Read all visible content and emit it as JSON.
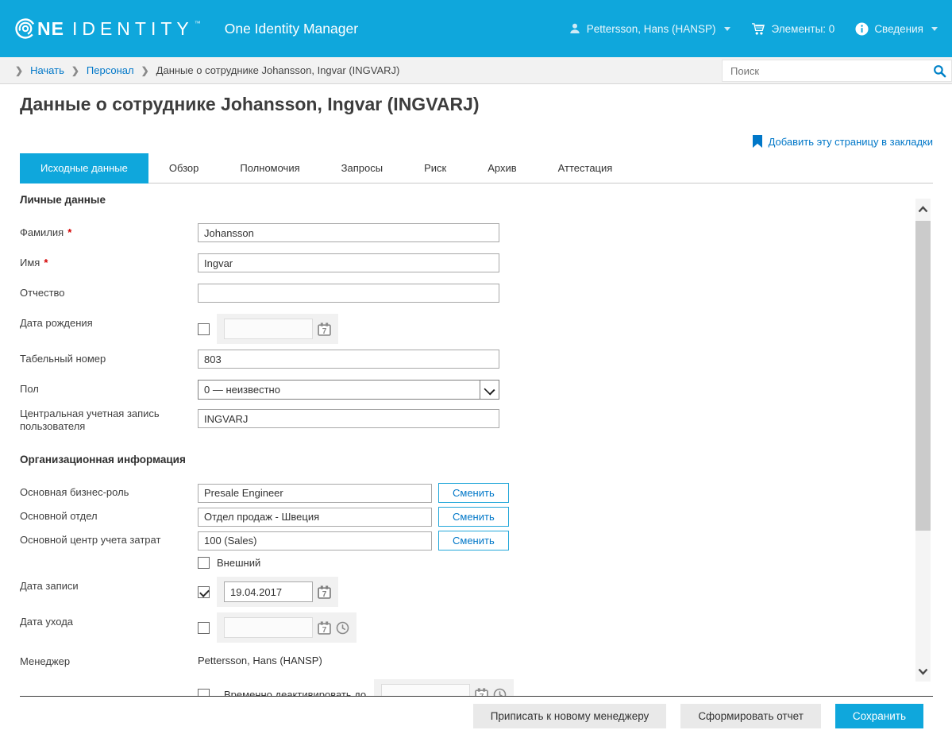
{
  "colors": {
    "accent": "#0FA7DC",
    "link": "#0077C8",
    "required": "#D40000"
  },
  "header": {
    "logo_bold": "NE",
    "logo_light": "IDENTITY",
    "logo_tm": "™",
    "app_title": "One Identity Manager",
    "user_label": "Pettersson, Hans (HANSP)",
    "cart_label": "Элементы: 0",
    "info_label": "Сведения"
  },
  "breadcrumb": {
    "home": "Начать",
    "section": "Персонал",
    "current": "Данные о сотруднике Johansson, Ingvar (INGVARJ)"
  },
  "search": {
    "placeholder": "Поиск"
  },
  "page": {
    "title": "Данные о сотруднике Johansson, Ingvar (INGVARJ)",
    "bookmark_label": "Добавить эту страницу в закладки"
  },
  "tabs": [
    {
      "label": "Исходные данные"
    },
    {
      "label": "Обзор"
    },
    {
      "label": "Полномочия"
    },
    {
      "label": "Запросы"
    },
    {
      "label": "Риск"
    },
    {
      "label": "Архив"
    },
    {
      "label": "Аттестация"
    }
  ],
  "form": {
    "personal_section": "Личные данные",
    "lastname": {
      "label": "Фамилия",
      "required": "*",
      "value": "Johansson"
    },
    "firstname": {
      "label": "Имя",
      "required": "*",
      "value": "Ingvar"
    },
    "middlename": {
      "label": "Отчество",
      "value": ""
    },
    "birthdate": {
      "label": "Дата рождения",
      "value": ""
    },
    "personnel_number": {
      "label": "Табельный номер",
      "value": "803"
    },
    "gender": {
      "label": "Пол",
      "value": "0 — неизвестно"
    },
    "central_account": {
      "label": "Центральная учетная запись пользователя",
      "value": "INGVARJ"
    },
    "org_section": "Организационная информация",
    "business_role": {
      "label": "Основная бизнес-роль",
      "value": "Presale Engineer",
      "button": "Сменить"
    },
    "department": {
      "label": "Основной отдел",
      "value": "Отдел продаж - Швеция",
      "button": "Сменить"
    },
    "cost_center": {
      "label": "Основной центр учета затрат",
      "value": "100 (Sales)",
      "button": "Сменить"
    },
    "external": {
      "label": "Внешний"
    },
    "entry_date": {
      "label": "Дата записи",
      "value": "19.04.2017"
    },
    "leaving_date": {
      "label": "Дата ухода",
      "value": ""
    },
    "manager": {
      "label": "Менеджер",
      "value": "Pettersson, Hans (HANSP)"
    },
    "deactivate_until": {
      "label": "Временно деактивировать до",
      "value": ""
    }
  },
  "footer": {
    "assign_button": "Приписать к новому менеджеру",
    "report_button": "Сформировать отчет",
    "save_button": "Сохранить"
  }
}
